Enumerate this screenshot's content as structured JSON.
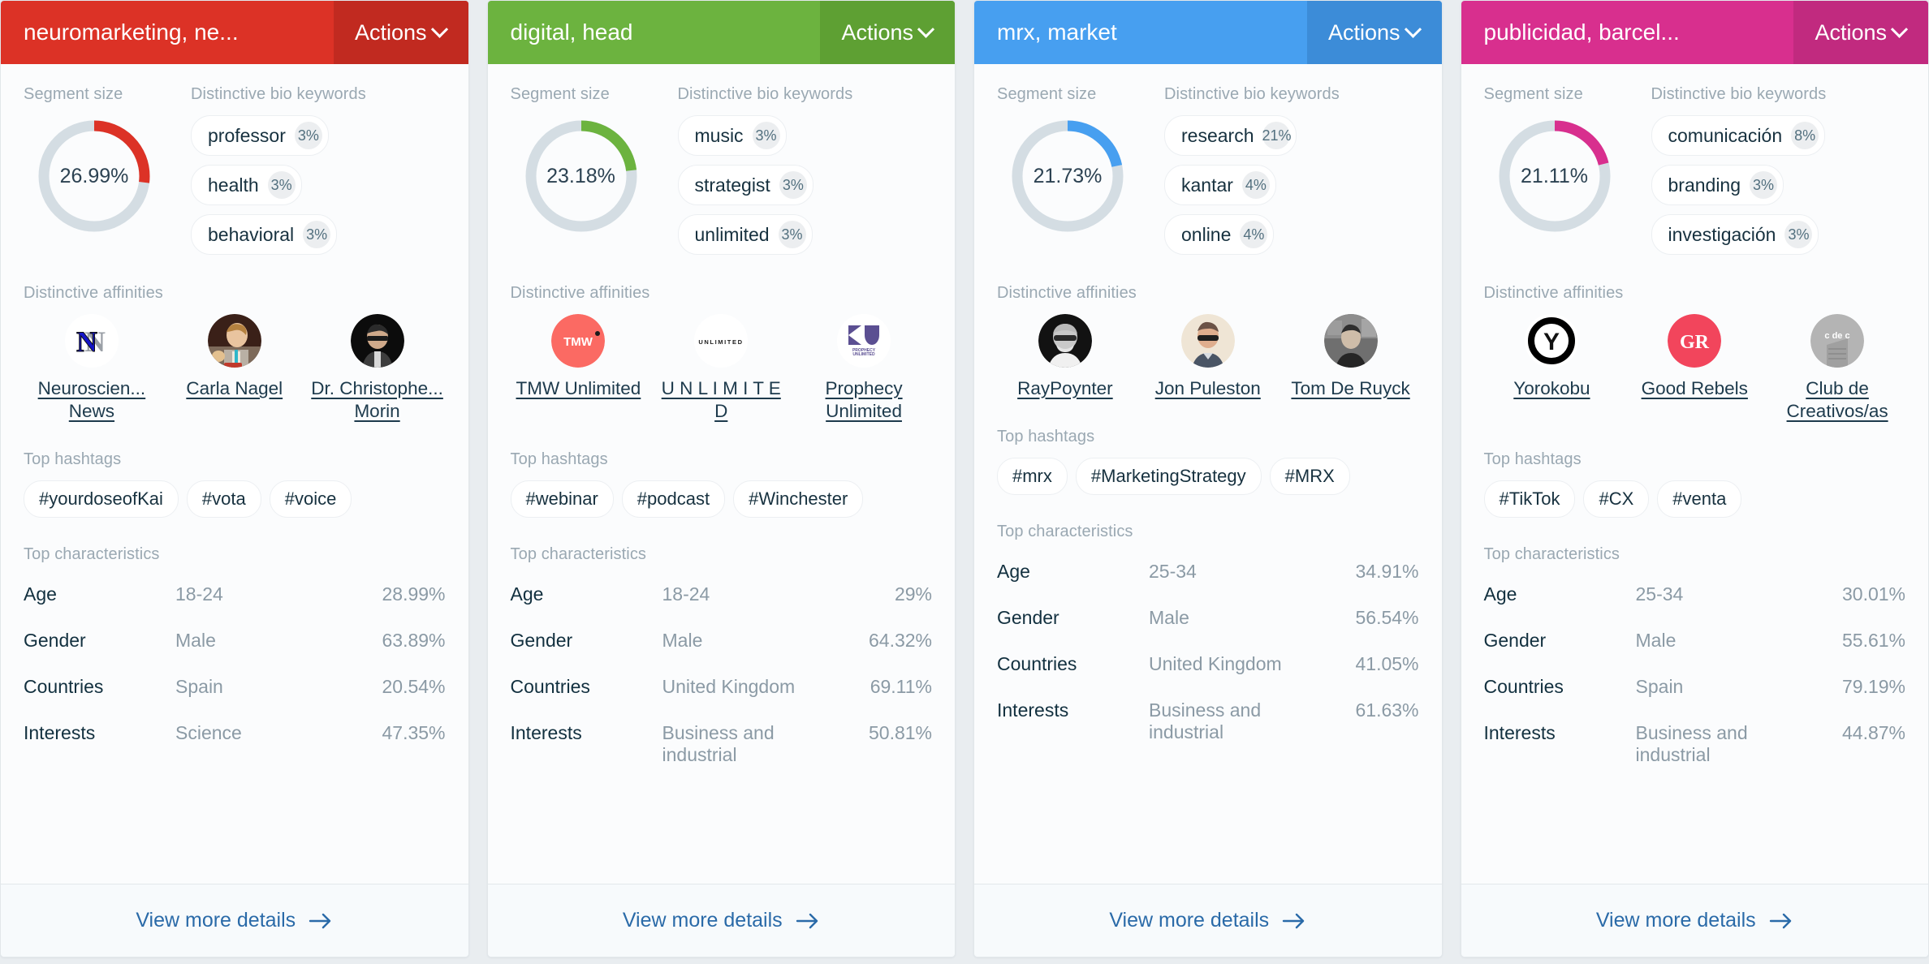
{
  "labels": {
    "segment_size": "Segment size",
    "bio_keywords": "Distinctive bio keywords",
    "affinities": "Distinctive affinities",
    "hashtags": "Top hashtags",
    "characteristics": "Top characteristics",
    "actions": "Actions",
    "view_more": "View more details"
  },
  "colors": {
    "card1": "#d9332c",
    "card1_dark": "#c02b25",
    "card2": "#68b council",
    "card2_main": "#6cb košík",
    "card3": "#4a9ff5",
    "card4": "#d62e8a"
  },
  "cards": [
    {
      "accent": "#dc3226",
      "accent_dark": "#c12a20",
      "title": "neuromarketing, ne...",
      "segment_size": "26.99%",
      "segment_pct": 26.99,
      "keywords": [
        {
          "name": "professor",
          "pct": "3%"
        },
        {
          "name": "health",
          "pct": "3%"
        },
        {
          "name": "behavioral",
          "pct": "3%"
        }
      ],
      "affinities": [
        {
          "name": "Neuroscien... News",
          "icon": "neuroscience-news-logo"
        },
        {
          "name": "Carla Nagel",
          "icon": "carla-nagel-avatar"
        },
        {
          "name": "Dr. Christophe... Morin",
          "icon": "christophe-morin-avatar"
        }
      ],
      "hashtags": [
        "#yourdoseofKai",
        "#vota",
        "#voice"
      ],
      "characteristics": [
        {
          "key": "Age",
          "value": "18-24",
          "pct": "28.99%"
        },
        {
          "key": "Gender",
          "value": "Male",
          "pct": "63.89%"
        },
        {
          "key": "Countries",
          "value": "Spain",
          "pct": "20.54%"
        },
        {
          "key": "Interests",
          "value": "Science",
          "pct": "47.35%"
        }
      ]
    },
    {
      "accent": "#6cb33f",
      "accent_dark": "#5ea033",
      "title": "digital, head",
      "segment_size": "23.18%",
      "segment_pct": 23.18,
      "keywords": [
        {
          "name": "music",
          "pct": "3%"
        },
        {
          "name": "strategist",
          "pct": "3%"
        },
        {
          "name": "unlimited",
          "pct": "3%"
        }
      ],
      "affinities": [
        {
          "name": "TMW Unlimited",
          "icon": "tmw-unlimited-logo"
        },
        {
          "name": "U N L I M I T E D",
          "icon": "unlimited-logo"
        },
        {
          "name": "Prophecy Unlimited",
          "icon": "prophecy-unlimited-logo"
        }
      ],
      "hashtags": [
        "#webinar",
        "#podcast",
        "#Winchester"
      ],
      "characteristics": [
        {
          "key": "Age",
          "value": "18-24",
          "pct": "29%"
        },
        {
          "key": "Gender",
          "value": "Male",
          "pct": "64.32%"
        },
        {
          "key": "Countries",
          "value": "United Kingdom",
          "pct": "69.11%"
        },
        {
          "key": "Interests",
          "value": "Business and industrial",
          "pct": "50.81%"
        }
      ]
    },
    {
      "accent": "#479ff0",
      "accent_dark": "#3c8cd8",
      "title": "mrx, market",
      "segment_size": "21.73%",
      "segment_pct": 21.73,
      "keywords": [
        {
          "name": "research",
          "pct": "21%"
        },
        {
          "name": "kantar",
          "pct": "4%"
        },
        {
          "name": "online",
          "pct": "4%"
        }
      ],
      "affinities": [
        {
          "name": "RayPoynter",
          "icon": "ray-poynter-avatar"
        },
        {
          "name": "Jon Puleston",
          "icon": "jon-puleston-avatar"
        },
        {
          "name": "Tom De Ruyck",
          "icon": "tom-de-ruyck-avatar"
        }
      ],
      "hashtags": [
        "#mrx",
        "#MarketingStrategy",
        "#MRX"
      ],
      "characteristics": [
        {
          "key": "Age",
          "value": "25-34",
          "pct": "34.91%"
        },
        {
          "key": "Gender",
          "value": "Male",
          "pct": "56.54%"
        },
        {
          "key": "Countries",
          "value": "United Kingdom",
          "pct": "41.05%"
        },
        {
          "key": "Interests",
          "value": "Business and industrial",
          "pct": "61.63%"
        }
      ]
    },
    {
      "accent": "#d82f8e",
      "accent_dark": "#c12a7f",
      "title": "publicidad, barcel...",
      "segment_size": "21.11%",
      "segment_pct": 21.11,
      "keywords": [
        {
          "name": "comunicación",
          "pct": "8%"
        },
        {
          "name": "branding",
          "pct": "3%"
        },
        {
          "name": "investigación",
          "pct": "3%"
        }
      ],
      "affinities": [
        {
          "name": "Yorokobu",
          "icon": "yorokobu-logo"
        },
        {
          "name": "Good Rebels",
          "icon": "good-rebels-logo"
        },
        {
          "name": "Club de Creativos/as",
          "icon": "club-de-creativos-logo"
        }
      ],
      "hashtags": [
        "#TikTok",
        "#CX",
        "#venta"
      ],
      "characteristics": [
        {
          "key": "Age",
          "value": "25-34",
          "pct": "30.01%"
        },
        {
          "key": "Gender",
          "value": "Male",
          "pct": "55.61%"
        },
        {
          "key": "Countries",
          "value": "Spain",
          "pct": "79.19%"
        },
        {
          "key": "Interests",
          "value": "Business and industrial",
          "pct": "44.87%"
        }
      ]
    }
  ]
}
